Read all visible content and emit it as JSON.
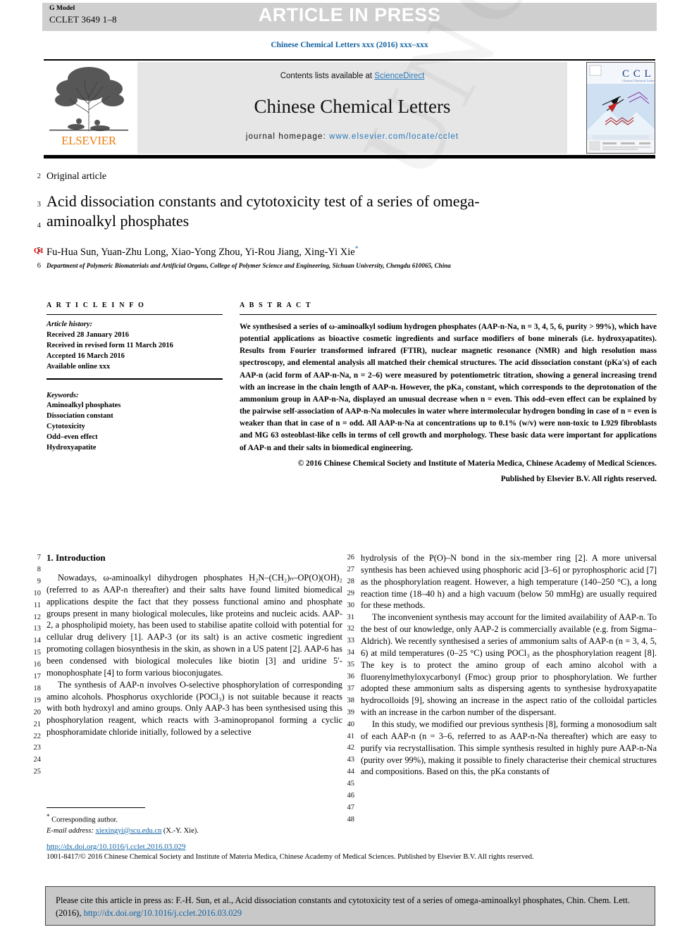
{
  "banner": {
    "gmodel_label": "G Model",
    "gmodel_code": "CCLET 3649 1–8",
    "article_in_press": "ARTICLE IN PRESS"
  },
  "journal_header": {
    "running_head": "Chinese Chemical Letters xxx (2016) xxx–xxx",
    "contents_prefix": "Contents lists available at ",
    "contents_link": "ScienceDirect",
    "journal_name": "Chinese Chemical Letters",
    "homepage_label": "journal homepage: ",
    "homepage_url": "www.elsevier.com/locate/cclet",
    "publisher": "ELSEVIER",
    "cover_label": "CCL",
    "cover_sub": "Chinese Chemical Letters"
  },
  "article": {
    "type": "Original article",
    "title": "Acid dissociation constants and cytotoxicity test of a series of omega-aminoalkyl phosphates",
    "query_tag": "Q1",
    "authors": "Fu-Hua Sun, Yuan-Zhu Long, Xiao-Yong Zhou, Yi-Rou Jiang, Xing-Yi Xie",
    "affiliation": "Department of Polymeric Biomaterials and Artificial Organs, College of Polymer Science and Engineering, Sichuan University, Chengdu 610065, China"
  },
  "article_info": {
    "heading": "A R T I C L E   I N F O",
    "history_label": "Article history:",
    "received": "Received 28 January 2016",
    "revised": "Received in revised form 11 March 2016",
    "accepted": "Accepted 16 March 2016",
    "available": "Available online xxx",
    "keywords_label": "Keywords:",
    "keywords": [
      "Aminoalkyl phosphates",
      "Dissociation constant",
      "Cytotoxicity",
      "Odd–even effect",
      "Hydroxyapatite"
    ]
  },
  "abstract": {
    "heading": "A B S T R A C T",
    "body": "We synthesised a series of ω-aminoalkyl sodium hydrogen phosphates (AAP-n-Na, n = 3, 4, 5, 6, purity > 99%), which have potential applications as bioactive cosmetic ingredients and surface modifiers of bone minerals (i.e. hydroxyapatites). Results from Fourier transformed infrared (FTIR), nuclear magnetic resonance (NMR) and high resolution mass spectroscopy, and elemental analysis all matched their chemical structures. The acid dissociation constant (pKa's) of each AAP-n (acid form of AAP-n-Na, n = 2–6) were measured by potentiometric titration, showing a general increasing trend with an increase in the chain length of AAP-n. However, the pKa₃ constant, which corresponds to the deprotonation of the ammonium group in AAP-n-Na, displayed an unusual decrease when n = even. This odd–even effect can be explained by the pairwise self-association of AAP-n-Na molecules in water where intermolecular hydrogen bonding in case of n = even is weaker than that in case of n = odd. All AAP-n-Na at concentrations up to 0.1% (w/v) were non-toxic to L929 fibroblasts and MG 63 osteoblast-like cells in terms of cell growth and morphology. These basic data were important for applications of AAP-n and their salts in biomedical engineering.",
    "copyright_line1": "© 2016 Chinese Chemical Society and Institute of Materia Medica, Chinese Academy of Medical Sciences.",
    "copyright_line2": "Published by Elsevier B.V. All rights reserved."
  },
  "introduction": {
    "heading": "1. Introduction",
    "left_paragraphs": [
      "Nowadays, ω-aminoalkyl dihydrogen phosphates H₂N–(CH₂)ₙ–OP(O)(OH)₂ (referred to as AAP-n thereafter) and their salts have found limited biomedical applications despite the fact that they possess functional amino and phosphate groups present in many biological molecules, like proteins and nucleic acids. AAP-2, a phospholipid moiety, has been used to stabilise apatite colloid with potential for cellular drug delivery [1]. AAP-3 (or its salt) is an active cosmetic ingredient promoting collagen biosynthesis in the skin, as shown in a US patent [2]. AAP-6 has been condensed with biological molecules like biotin [3] and uridine 5′-monophosphate [4] to form various bioconjugates.",
      "The synthesis of AAP-n involves O-selective phosphorylation of corresponding amino alcohols. Phosphorus oxychloride (POCl₃) is not suitable because it reacts with both hydroxyl and amino groups. Only AAP-3 has been synthesised using this phosphorylation reagent, which reacts with 3-aminopropanol forming a cyclic phosphoramidate chloride initially, followed by a selective"
    ],
    "right_paragraphs": [
      "hydrolysis of the P(O)–N bond in the six-member ring [2]. A more universal synthesis has been achieved using phosphoric acid [3–6] or pyrophosphoric acid [7] as the phosphorylation reagent. However, a high temperature (140–250 °C), a long reaction time (18–40 h) and a high vacuum (below 50 mmHg) are usually required for these methods.",
      "The inconvenient synthesis may account for the limited availability of AAP-n. To the best of our knowledge, only AAP-2 is commercially available (e.g. from Sigma–Aldrich). We recently synthesised a series of ammonium salts of AAP-n (n = 3, 4, 5, 6) at mild temperatures (0–25 °C) using POCl₃ as the phosphorylation reagent [8]. The key is to protect the amino group of each amino alcohol with a fluorenylmethyloxycarbonyl (Fmoc) group prior to phosphorylation. We further adopted these ammonium salts as dispersing agents to synthesise hydroxyapatite hydrocolloids [9], showing an increase in the aspect ratio of the colloidal particles with an increase in the carbon number of the dispersant.",
      "In this study, we modified our previous synthesis [8], forming a monosodium salt of each AAP-n (n = 3–6, referred to as AAP-n-Na thereafter) which are easy to purify via recrystallisation. This simple synthesis resulted in highly pure AAP-n-Na (purity over 99%), making it possible to finely characterise their chemical structures and compositions. Based on this, the pKa constants of"
    ]
  },
  "footnote": {
    "corresponding_label": "Corresponding author.",
    "email_label": "E-mail address:",
    "email": "xiexingyi@scu.edu.cn",
    "email_suffix": "(X.-Y. Xie).",
    "doi": "http://dx.doi.org/10.1016/j.cclet.2016.03.029",
    "issn_line": "1001-8417/© 2016 Chinese Chemical Society and Institute of Materia Medica, Chinese Academy of Medical Sciences. Published by Elsevier B.V. All rights reserved."
  },
  "citation_box": {
    "text_before": "Please cite this article in press as: F.-H. Sun, et al., Acid dissociation constants and cytotoxicity test of a series of omega-aminoalkyl phosphates, Chin. Chem. Lett. (2016), ",
    "link": "http://dx.doi.org/10.1016/j.cclet.2016.03.029"
  },
  "line_numbers": {
    "title_block": [
      "2",
      "3",
      "4",
      "5",
      "6"
    ],
    "left_column": [
      "7",
      "8",
      "9",
      "10",
      "11",
      "12",
      "13",
      "14",
      "15",
      "16",
      "17",
      "18",
      "19",
      "20",
      "21",
      "22",
      "23",
      "24",
      "25"
    ],
    "right_column": [
      "26",
      "27",
      "28",
      "29",
      "30",
      "31",
      "32",
      "33",
      "34",
      "35",
      "36",
      "37",
      "38",
      "39",
      "40",
      "41",
      "42",
      "43",
      "44",
      "45",
      "46",
      "47",
      "48"
    ]
  },
  "colors": {
    "link": "#1463a3",
    "elsevier_orange": "#f07f13",
    "query_red": "#e00000",
    "banner_gray": "#cfcfcf",
    "panel_gray": "#e6e6e6",
    "cite_gray": "#c8c8c8"
  }
}
